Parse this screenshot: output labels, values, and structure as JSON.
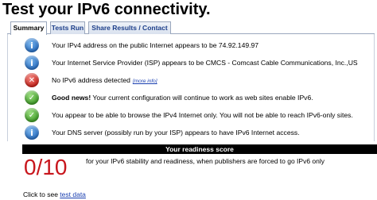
{
  "page": {
    "title": "Test your IPv6 connectivity."
  },
  "tabs": [
    {
      "label": "Summary",
      "active": true
    },
    {
      "label": "Tests Run",
      "active": false
    },
    {
      "label": "Share Results / Contact",
      "active": false
    }
  ],
  "results": [
    {
      "status": "info",
      "icon": "info-icon",
      "text": "Your IPv4 address on the public Internet appears to be 74.92.149.97"
    },
    {
      "status": "info",
      "icon": "info-icon",
      "text": "Your Internet Service Provider (ISP) appears to be CMCS - Comcast Cable Communications, Inc.,US"
    },
    {
      "status": "error",
      "icon": "error-icon",
      "text": "No IPv6 address detected",
      "link": "[more info]"
    },
    {
      "status": "ok",
      "icon": "checkmark-icon",
      "bold": "Good news!",
      "text": " Your current configuration will continue to work as web sites enable IPv6."
    },
    {
      "status": "ok",
      "icon": "checkmark-icon",
      "text": "You appear to be able to browse the IPv4 Internet only. You will not be able to reach IPv6-only sites."
    },
    {
      "status": "info",
      "icon": "info-icon",
      "text": "Your DNS server (possibly run by your ISP) appears to have IPv6 Internet access."
    }
  ],
  "readiness": {
    "header": "Your readiness score",
    "score": "0/10",
    "description": "for your IPv6 stability and readiness, when publishers are forced to go IPv6 only"
  },
  "footer": {
    "prefix": "Click to see ",
    "link": "test data"
  },
  "colors": {
    "score": "#c8161d",
    "link": "#1a3fb0",
    "info": "#2a6fc2",
    "error": "#c8231b",
    "ok": "#3f9b27"
  }
}
